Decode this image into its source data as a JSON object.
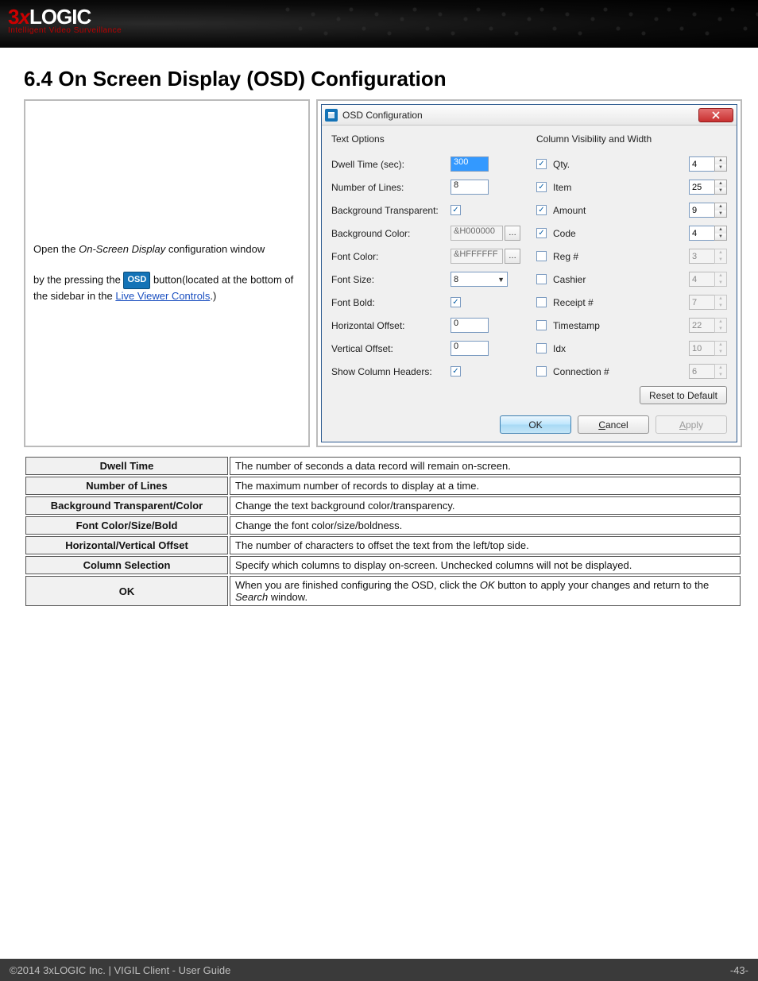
{
  "header": {
    "logo_prefix": "3",
    "logo_x": "x",
    "logo_rest": "LOGIC",
    "tagline": "Intelligent Video Surveillance"
  },
  "section_title": "6.4 On Screen Display (OSD) Configuration",
  "intro": {
    "p1a": "Open the ",
    "p1b": "On-Screen Display",
    "p1c": "  configuration window",
    "p2a": "by the pressing the ",
    "osd_btn": "OSD",
    "p2b": " button(located at the bottom of the sidebar in the ",
    "link": "Live Viewer Controls",
    "p2c": ".)"
  },
  "dialog": {
    "title": "OSD Configuration",
    "left_header": "Text Options",
    "right_header": "Column Visibility and Width",
    "text_options": [
      {
        "label": "Dwell Time (sec):",
        "type": "text",
        "value": "300",
        "selected": true
      },
      {
        "label": "Number of Lines:",
        "type": "text",
        "value": "8"
      },
      {
        "label": "Background Transparent:",
        "type": "check",
        "checked": true
      },
      {
        "label": "Background Color:",
        "type": "color",
        "value": "&H000000",
        "disabled": true
      },
      {
        "label": "Font Color:",
        "type": "color",
        "value": "&HFFFFFF",
        "disabled": true
      },
      {
        "label": "Font Size:",
        "type": "combo",
        "value": "8"
      },
      {
        "label": "Font Bold:",
        "type": "check",
        "checked": true
      },
      {
        "label": "Horizontal Offset:",
        "type": "text",
        "value": "0"
      },
      {
        "label": "Vertical Offset:",
        "type": "text",
        "value": "0"
      },
      {
        "label": "Show Column Headers:",
        "type": "check",
        "checked": true
      }
    ],
    "columns": [
      {
        "label": "Qty.",
        "checked": true,
        "width": "4"
      },
      {
        "label": "Item",
        "checked": true,
        "width": "25"
      },
      {
        "label": "Amount",
        "checked": true,
        "width": "9"
      },
      {
        "label": "Code",
        "checked": true,
        "width": "4"
      },
      {
        "label": "Reg #",
        "checked": false,
        "width": "3"
      },
      {
        "label": "Cashier",
        "checked": false,
        "width": "4"
      },
      {
        "label": "Receipt #",
        "checked": false,
        "width": "7"
      },
      {
        "label": "Timestamp",
        "checked": false,
        "width": "22"
      },
      {
        "label": "Idx",
        "checked": false,
        "width": "10"
      },
      {
        "label": "Connection #",
        "checked": false,
        "width": "6"
      }
    ],
    "reset": "Reset to Default",
    "ok": "OK",
    "cancel_u": "C",
    "cancel_r": "ancel",
    "apply_u": "A",
    "apply_r": "pply"
  },
  "defs": [
    {
      "term": "Dwell Time",
      "def": "The number of seconds a data record will remain on-screen."
    },
    {
      "term": "Number of Lines",
      "def": "The maximum number of records to display at a time."
    },
    {
      "term": "Background Transparent/Color",
      "def": "Change the text background color/transparency."
    },
    {
      "term": "Font Color/Size/Bold",
      "def": "Change the font color/size/boldness."
    },
    {
      "term": "Horizontal/Vertical Offset",
      "def": "The number of characters to offset the text from the left/top side."
    },
    {
      "term": "Column Selection",
      "def": "Specify which columns to display on-screen. Unchecked columns will not be displayed."
    }
  ],
  "def_ok": {
    "term": "OK",
    "a": "When you are finished configuring the OSD, click the ",
    "b": "OK",
    "c": " button to apply your changes and return to the ",
    "d": "Search",
    "e": " window."
  },
  "footer": {
    "left": "©2014 3xLOGIC Inc.  |  VIGIL Client - User Guide",
    "right": "-43-"
  }
}
